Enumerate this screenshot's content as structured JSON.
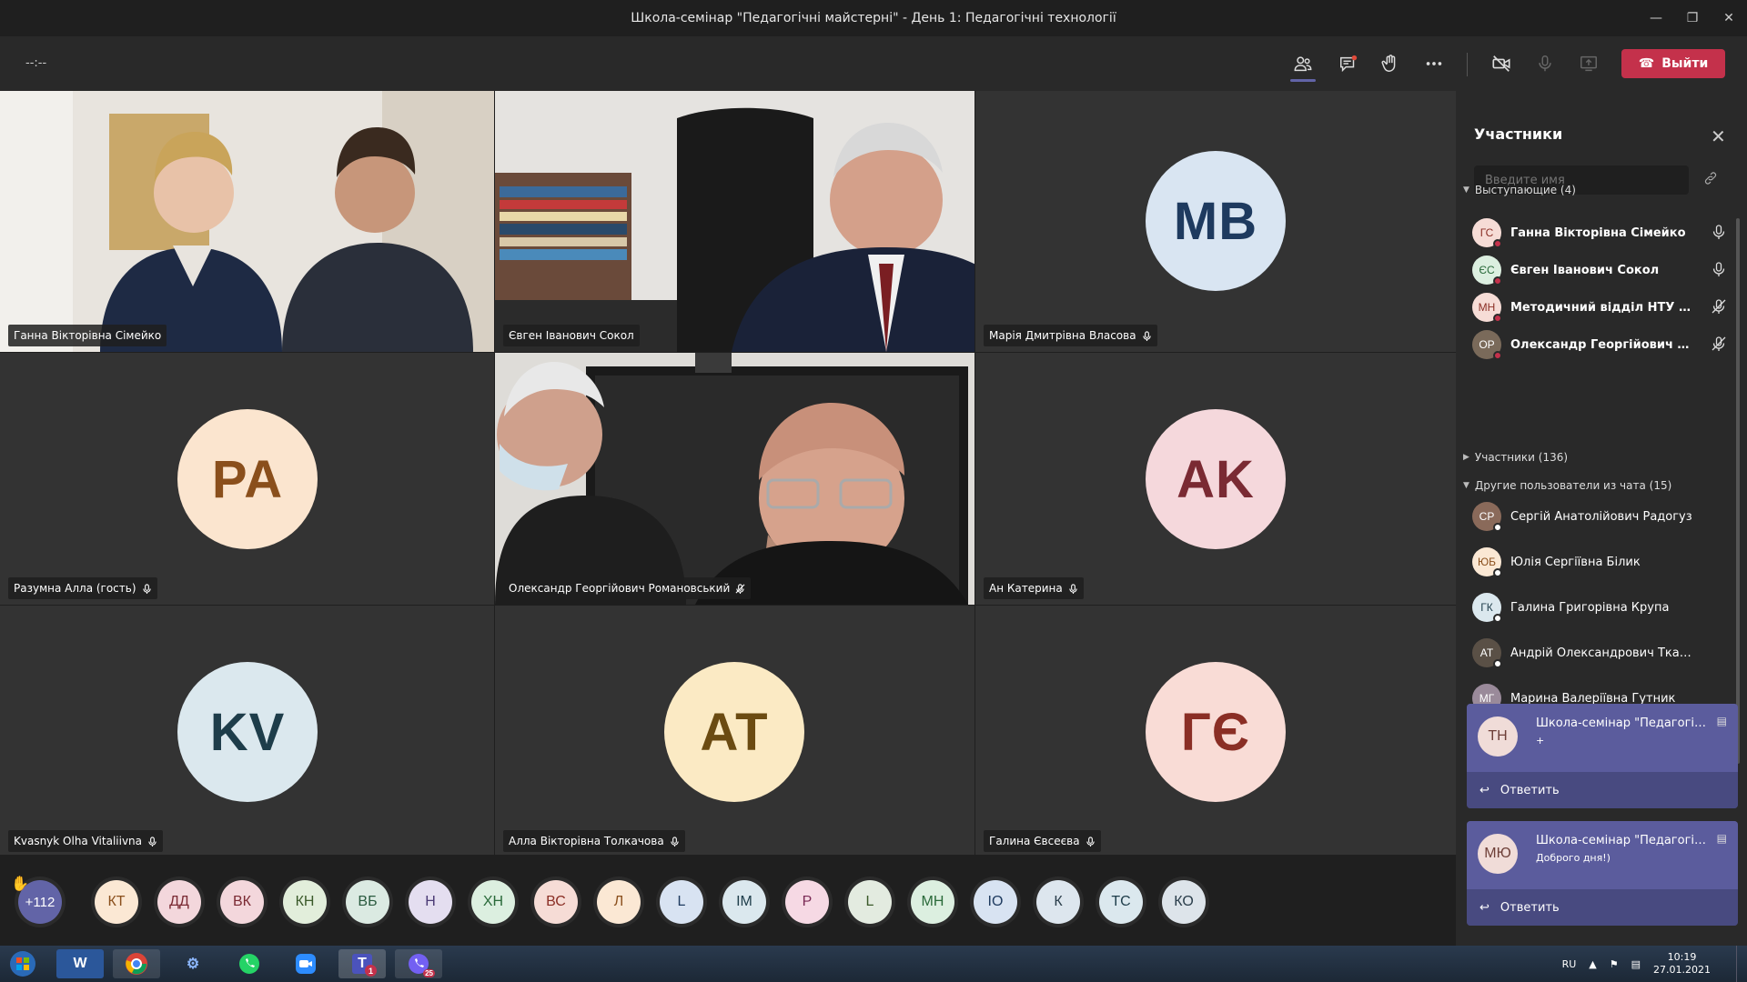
{
  "window": {
    "title": "Школа-семінар \"Педагогічні майстерні\" - День 1: Педагогічні технології"
  },
  "toolbar": {
    "timer": "--:--",
    "leave_label": "Выйти"
  },
  "tiles": [
    {
      "name": "Ганна Вікторівна Сімейко",
      "type": "video",
      "mic": "none"
    },
    {
      "name": "Євген Іванович Сокол",
      "type": "video",
      "mic": "none"
    },
    {
      "name": "Марія Дмитрівна Власова",
      "type": "avatar",
      "initials": "MB",
      "bg": "#d9e5f2",
      "fg": "#1e3a5f",
      "mic": "on"
    },
    {
      "name": "Разумна Алла (гость)",
      "type": "avatar",
      "initials": "PA",
      "bg": "#fbe5cf",
      "fg": "#8a4f1c",
      "mic": "on"
    },
    {
      "name": "Олександр Георгійович Романовський",
      "type": "video",
      "mic": "muted"
    },
    {
      "name": "Ан Катерина",
      "type": "avatar",
      "initials": "AK",
      "bg": "#f5d8dc",
      "fg": "#7a2a33",
      "mic": "on"
    },
    {
      "name": "Kvasnyk Olha Vitaliivna",
      "type": "avatar",
      "initials": "KV",
      "bg": "#dbe8ee",
      "fg": "#1e3d4a",
      "mic": "on"
    },
    {
      "name": "Алла Вікторівна Толкачова",
      "type": "avatar",
      "initials": "AT",
      "bg": "#fbeac4",
      "fg": "#6b4b12",
      "mic": "on"
    },
    {
      "name": "Галина Євсеєва",
      "type": "avatar",
      "initials": "ГЄ",
      "bg": "#f9dcd6",
      "fg": "#8a2e25",
      "mic": "on"
    }
  ],
  "tray": {
    "overflow": "+112",
    "avatars": [
      {
        "i": "КТ",
        "bg": "#fbe8d4",
        "fg": "#8a4f1c"
      },
      {
        "i": "ДД",
        "bg": "#f3d7dc",
        "fg": "#7a2a33"
      },
      {
        "i": "ВК",
        "bg": "#f3d7dc",
        "fg": "#7a2a33"
      },
      {
        "i": "КН",
        "bg": "#e2eedb",
        "fg": "#3b5a2a"
      },
      {
        "i": "ВБ",
        "bg": "#dbeae2",
        "fg": "#2a5a3f"
      },
      {
        "i": "Н",
        "bg": "#e4def0",
        "fg": "#4b3b75"
      },
      {
        "i": "ХН",
        "bg": "#dcefe0",
        "fg": "#2a6a3a"
      },
      {
        "i": "ВС",
        "bg": "#f6dcd6",
        "fg": "#8a2e25"
      },
      {
        "i": "Л",
        "bg": "#fbe8d4",
        "fg": "#8a4f1c"
      },
      {
        "i": "L",
        "bg": "#d8e3f2",
        "fg": "#1e3a5f"
      },
      {
        "i": "ІМ",
        "bg": "#dbe8ee",
        "fg": "#1e3d4a"
      },
      {
        "i": "Р",
        "bg": "#f6d9e4",
        "fg": "#7a2a55"
      },
      {
        "i": "L",
        "bg": "#e3ebe0",
        "fg": "#3b5a2a"
      },
      {
        "i": "МН",
        "bg": "#dcefe0",
        "fg": "#2a6a3a"
      },
      {
        "i": "ІО",
        "bg": "#d8e3f2",
        "fg": "#1e3a5f"
      },
      {
        "i": "К",
        "bg": "#dde6ee",
        "fg": "#2a3d4a"
      },
      {
        "i": "ТС",
        "bg": "#dbe8ee",
        "fg": "#1e3d4a"
      },
      {
        "i": "КО",
        "bg": "#dde4ea",
        "fg": "#2a3d4a"
      }
    ]
  },
  "panel": {
    "title": "Участники",
    "search_placeholder": "Введите имя",
    "presenters_header": "Выступающие (4)",
    "attendees_header": "Участники (136)",
    "others_header": "Другие пользователи из чата (15)",
    "presenters": [
      {
        "name": "Ганна Вікторівна Сімейко",
        "i": "ГС",
        "bg": "#f6dcd6",
        "fg": "#8a2e25",
        "mic": "on"
      },
      {
        "name": "Євген Іванович Сокол",
        "i": "ЄС",
        "bg": "#dcefe0",
        "fg": "#2a6a3a",
        "mic": "on"
      },
      {
        "name": "Методичний відділ НТУ \"ХПІ\"",
        "i": "МН",
        "bg": "#f6dcd6",
        "fg": "#8a2e25",
        "mic": "muted"
      },
      {
        "name": "Олександр Георгійович Ром...",
        "i": "ОР",
        "bg": "#7a6a5a",
        "fg": "#fff",
        "mic": "muted"
      }
    ],
    "others": [
      {
        "name": "Сергій Анатолійович Радогуз",
        "i": "СР",
        "bg": "#8a6a5a",
        "fg": "#fff"
      },
      {
        "name": "Юлія Сергіївна Білик",
        "i": "ЮБ",
        "bg": "#fbe8d4",
        "fg": "#8a4f1c"
      },
      {
        "name": "Галина Григорівна Крупа",
        "i": "ГК",
        "bg": "#dbe8ee",
        "fg": "#1e3d4a"
      },
      {
        "name": "Андрій Олександрович Ткаченко",
        "i": "АТ",
        "bg": "#5a5046",
        "fg": "#fff"
      },
      {
        "name": "Марина Валеріївна Гутник",
        "i": "МГ",
        "bg": "#9a8a9a",
        "fg": "#fff"
      }
    ]
  },
  "toasts": [
    {
      "initials": "ТН",
      "title": "Школа-семінар \"Педагогічн...",
      "message": "+",
      "reply": "Ответить"
    },
    {
      "initials": "МЮ",
      "title": "Школа-семінар \"Педагогічн...",
      "message": "Доброго дня!)",
      "reply": "Ответить"
    }
  ],
  "taskbar": {
    "lang": "RU",
    "time": "10:19",
    "date": "27.01.2021",
    "teams_badge": "1",
    "viber_badge": "25"
  },
  "colors": {
    "accent": "#6264a7",
    "leave": "#c4314b",
    "muted_red": "#c4314b"
  }
}
